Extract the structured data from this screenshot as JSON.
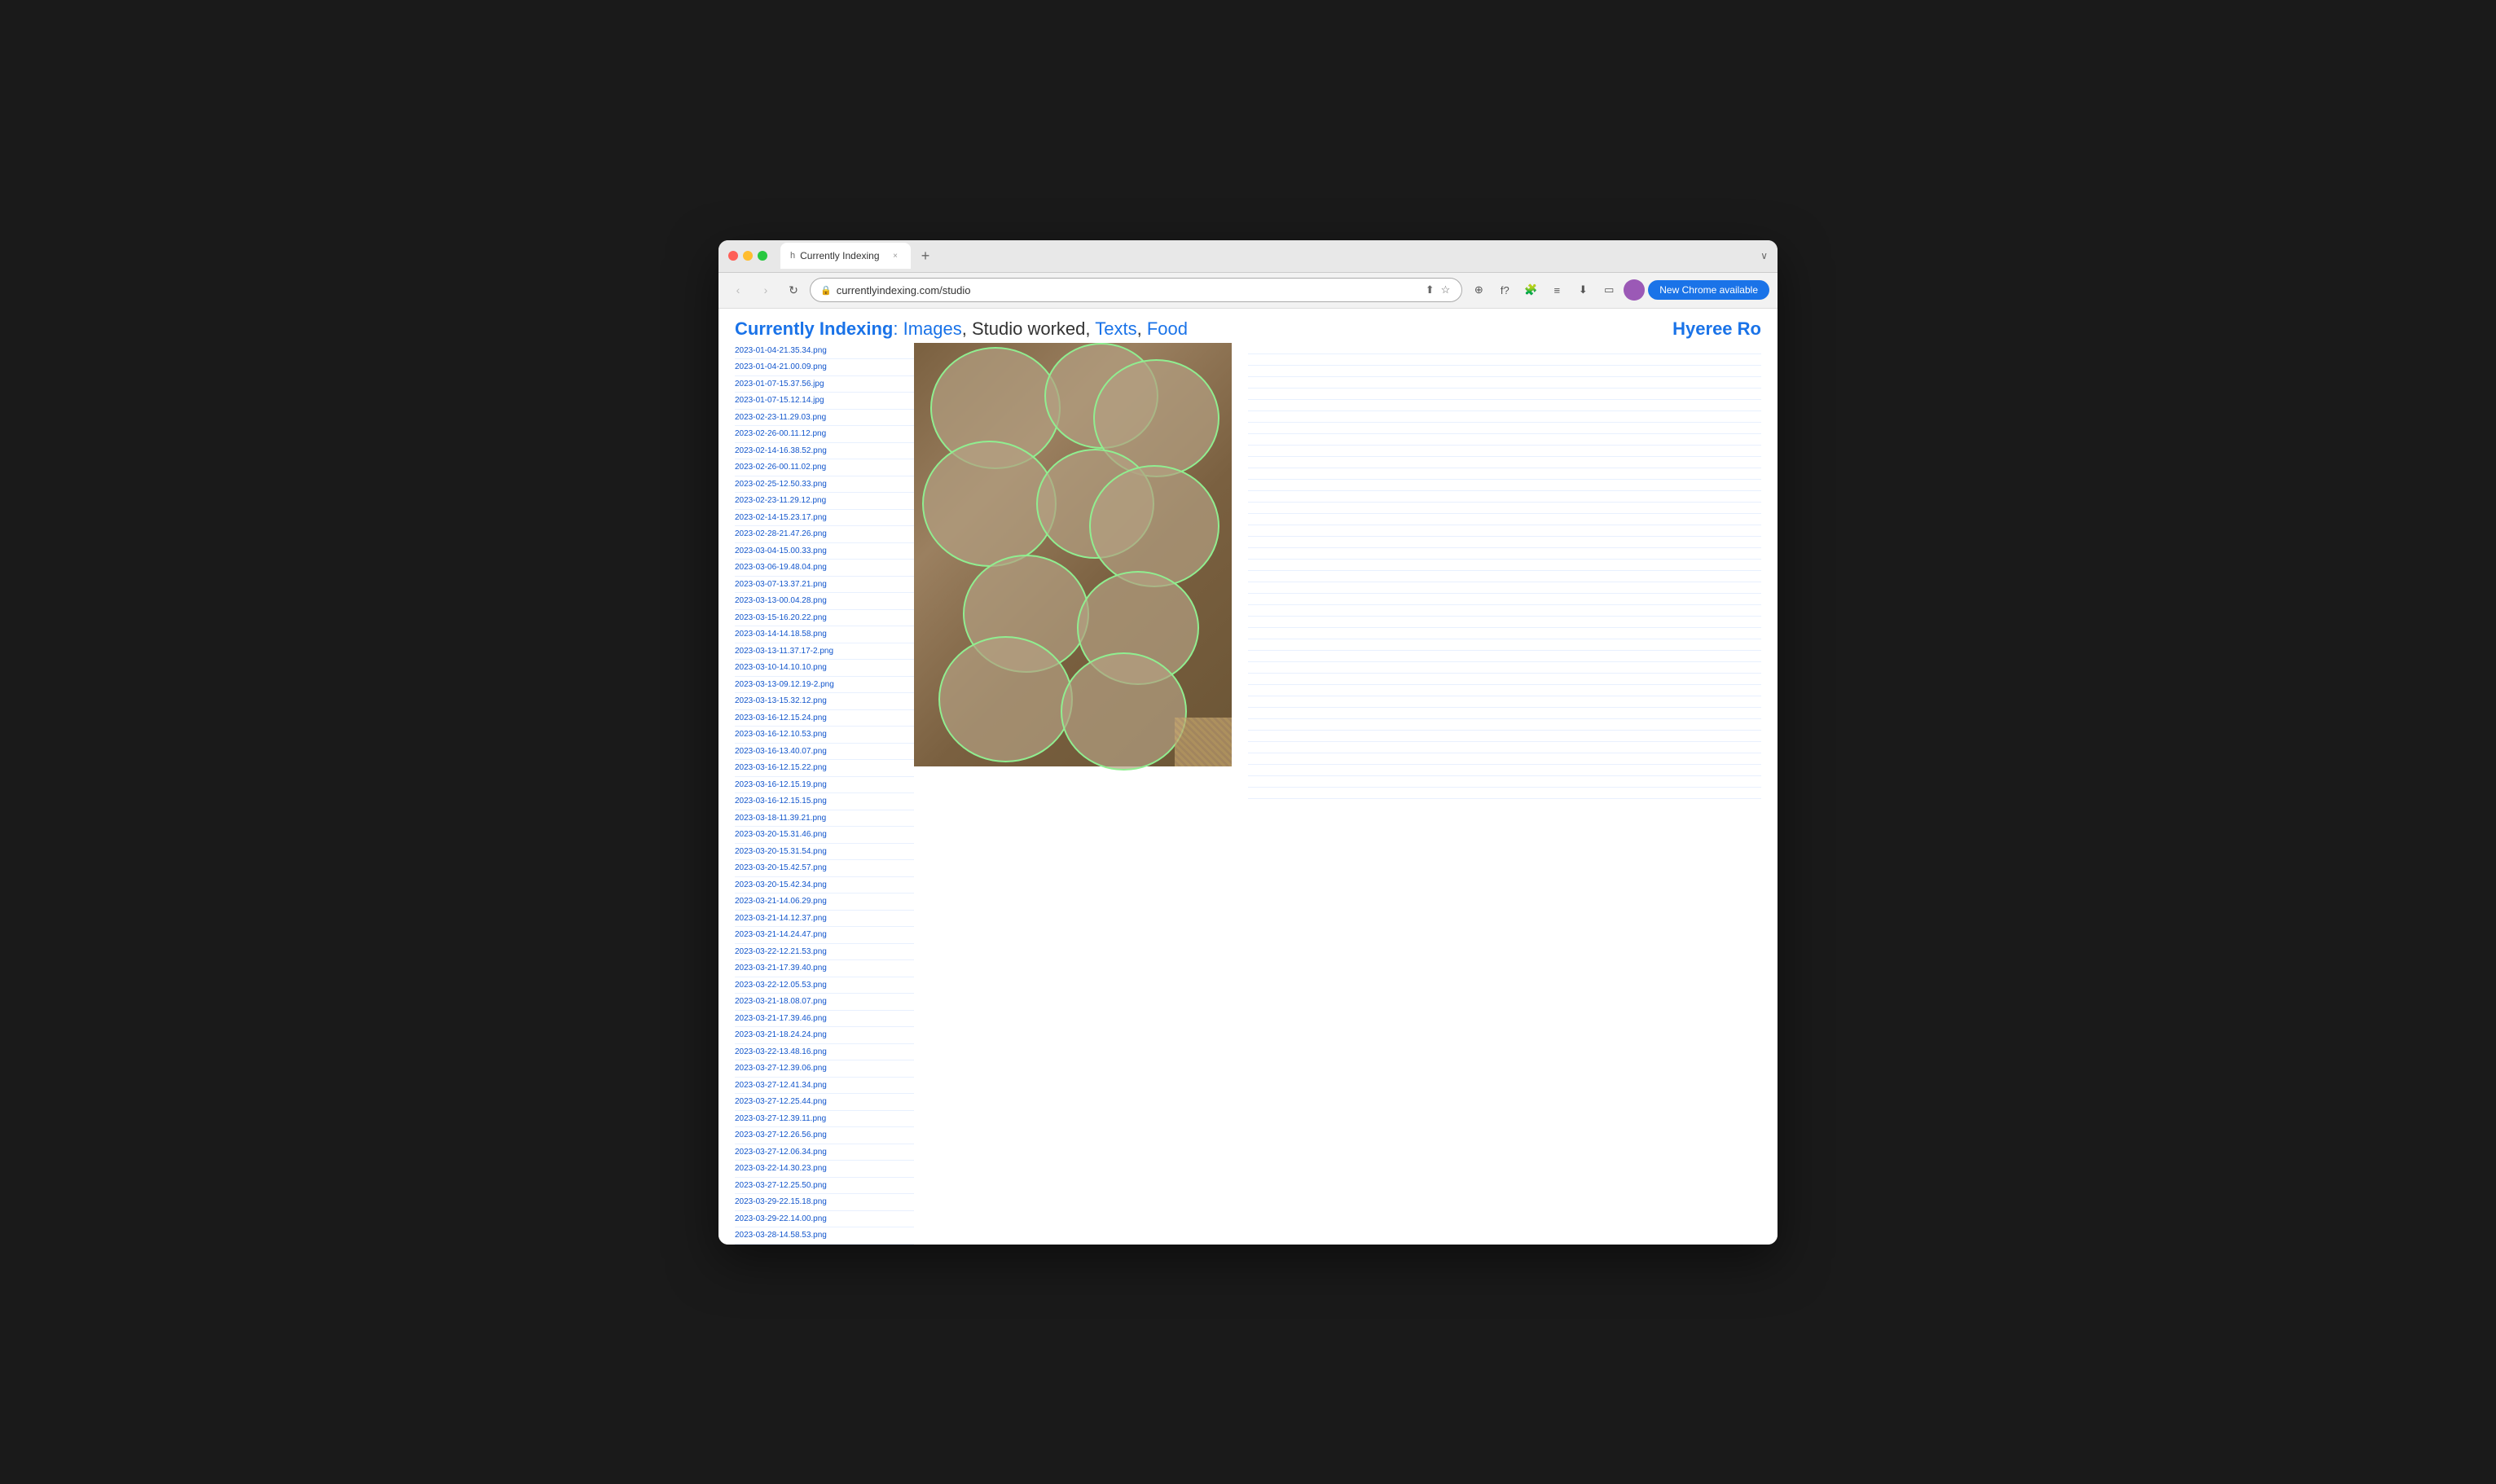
{
  "browser": {
    "tab_title": "Currently Indexing",
    "tab_favicon": "h",
    "new_tab_label": "+",
    "url": "currentlyindexing.com/studio",
    "back_icon": "‹",
    "forward_icon": "›",
    "refresh_icon": "↻",
    "chrome_update": "New Chrome available",
    "dropdown_arrow": "∨"
  },
  "page": {
    "site_name": "Currently Indexing",
    "colon": ":",
    "nav_images": "Images",
    "nav_separator1": ", Studio worked, ",
    "nav_texts": "Texts",
    "nav_separator2": ", ",
    "nav_food": "Food",
    "user_name": "Hyeree Ro"
  },
  "files": [
    "2023-01-04-21.35.34.png",
    "2023-01-04-21.00.09.png",
    "2023-01-07-15.37.56.jpg",
    "2023-01-07-15.12.14.jpg",
    "2023-02-23-11.29.03.png",
    "2023-02-26-00.11.12.png",
    "2023-02-14-16.38.52.png",
    "2023-02-26-00.11.02.png",
    "2023-02-25-12.50.33.png",
    "2023-02-23-11.29.12.png",
    "2023-02-14-15.23.17.png",
    "2023-02-28-21.47.26.png",
    "2023-03-04-15.00.33.png",
    "2023-03-06-19.48.04.png",
    "2023-03-07-13.37.21.png",
    "2023-03-13-00.04.28.png",
    "2023-03-15-16.20.22.png",
    "2023-03-14-14.18.58.png",
    "2023-03-13-11.37.17-2.png",
    "2023-03-10-14.10.10.png",
    "2023-03-13-09.12.19-2.png",
    "2023-03-13-15.32.12.png",
    "2023-03-16-12.15.24.png",
    "2023-03-16-12.10.53.png",
    "2023-03-16-13.40.07.png",
    "2023-03-16-12.15.22.png",
    "2023-03-16-12.15.19.png",
    "2023-03-16-12.15.15.png",
    "2023-03-18-11.39.21.png",
    "2023-03-20-15.31.46.png",
    "2023-03-20-15.31.54.png",
    "2023-03-20-15.42.57.png",
    "2023-03-20-15.42.34.png",
    "2023-03-21-14.06.29.png",
    "2023-03-21-14.12.37.png",
    "2023-03-21-14.24.47.png",
    "2023-03-22-12.21.53.png",
    "2023-03-21-17.39.40.png",
    "2023-03-22-12.05.53.png",
    "2023-03-21-18.08.07.png",
    "2023-03-21-17.39.46.png",
    "2023-03-21-18.24.24.png",
    "2023-03-22-13.48.16.png",
    "2023-03-27-12.39.06.png",
    "2023-03-27-12.41.34.png",
    "2023-03-27-12.25.44.png",
    "2023-03-27-12.39.11.png",
    "2023-03-27-12.26.56.png",
    "2023-03-27-12.06.34.png",
    "2023-03-22-14.30.23.png",
    "2023-03-27-12.25.50.png",
    "2023-03-29-22.15.18.png",
    "2023-03-29-22.14.00.png",
    "2023-03-28-14.58.53.png"
  ]
}
